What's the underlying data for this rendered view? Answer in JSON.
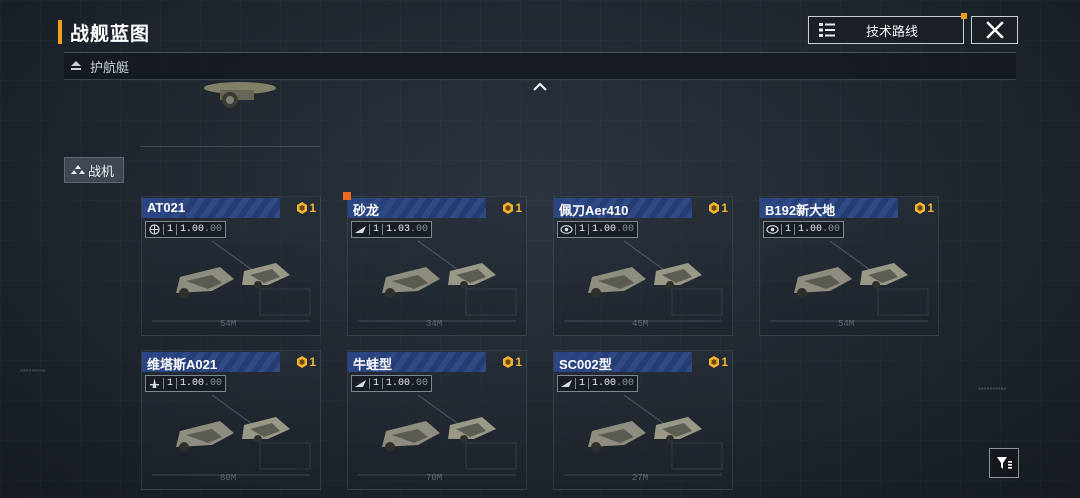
{
  "header": {
    "title": "战舰蓝图",
    "tech_route_label": "技术路线"
  },
  "category": {
    "label": "护航艇"
  },
  "subcategory": {
    "label": "战机"
  },
  "ships": [
    {
      "name": "AT021",
      "badge": "1",
      "level": "1",
      "version": "1.00",
      "version_suffix": ".00",
      "type_icon": "globe-icon",
      "length": "54M",
      "notice": false
    },
    {
      "name": "砂龙",
      "badge": "1",
      "level": "1",
      "version": "1.03",
      "version_suffix": ".00",
      "type_icon": "wing-icon",
      "length": "34M",
      "notice": true
    },
    {
      "name": "佩刀Aer410",
      "badge": "1",
      "level": "1",
      "version": "1.00",
      "version_suffix": ".00",
      "type_icon": "eye-icon",
      "length": "45M",
      "notice": false
    },
    {
      "name": "B192新大地",
      "badge": "1",
      "level": "1",
      "version": "1.00",
      "version_suffix": ".00",
      "type_icon": "eye-icon",
      "length": "54M",
      "notice": false
    },
    {
      "name": "维塔斯A021",
      "badge": "1",
      "level": "1",
      "version": "1.00",
      "version_suffix": ".00",
      "type_icon": "tower-icon",
      "length": "80M",
      "notice": false
    },
    {
      "name": "牛蛙型",
      "badge": "1",
      "level": "1",
      "version": "1.00",
      "version_suffix": ".00",
      "type_icon": "wing-icon",
      "length": "70M",
      "notice": false
    },
    {
      "name": "SC002型",
      "badge": "1",
      "level": "1",
      "version": "1.00",
      "version_suffix": ".00",
      "type_icon": "wing-icon",
      "length": "27M",
      "notice": false
    }
  ],
  "colors": {
    "accent": "#f0a020",
    "badge": "#f3b532",
    "name_bar": "#2f4a86",
    "background": "#232a33"
  }
}
